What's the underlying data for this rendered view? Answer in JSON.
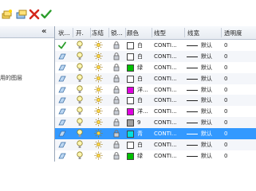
{
  "toolbar": {
    "buttons": [
      {
        "icon": "new-layer-icon"
      },
      {
        "icon": "new-layer-vp-icon"
      },
      {
        "icon": "delete-layer-icon"
      },
      {
        "icon": "set-current-icon"
      }
    ]
  },
  "left_panel": {
    "collapse_label": "«",
    "partial_text": "用的图层"
  },
  "table": {
    "headers": [
      "状...",
      "开.",
      "冻结",
      "锁...",
      "颜色",
      "线型",
      "线宽",
      "透明度"
    ],
    "rows": [
      {
        "status": "current",
        "color_hex": "#ffffff",
        "color_name": "白",
        "linetype": "CONTI...",
        "lineweight": "默认",
        "transparency": "0"
      },
      {
        "status": "layer",
        "color_hex": "#ffffff",
        "color_name": "白",
        "linetype": "CONTI...",
        "lineweight": "默认",
        "transparency": "0"
      },
      {
        "status": "layer",
        "color_hex": "#00c000",
        "color_name": "绿",
        "linetype": "CONTI...",
        "lineweight": "默认",
        "transparency": "0"
      },
      {
        "status": "layer",
        "color_hex": "#ffffff",
        "color_name": "白",
        "linetype": "CONTI...",
        "lineweight": "默认",
        "transparency": "0"
      },
      {
        "status": "layer",
        "color_hex": "#e000e0",
        "color_name": "洋...",
        "linetype": "CONTI...",
        "lineweight": "默认",
        "transparency": "0"
      },
      {
        "status": "layer",
        "color_hex": "#ffffff",
        "color_name": "白",
        "linetype": "CONTI...",
        "lineweight": "默认",
        "transparency": "0"
      },
      {
        "status": "layer",
        "color_hex": "#e000e0",
        "color_name": "洋...",
        "linetype": "CONTI...",
        "lineweight": "默认",
        "transparency": "0"
      },
      {
        "status": "layer",
        "color_hex": "#a0a0a0",
        "color_name": "9",
        "linetype": "CONTI...",
        "lineweight": "默认",
        "transparency": "0"
      },
      {
        "status": "selected",
        "color_hex": "#00e0e0",
        "color_name": "青",
        "linetype": "CONTI...",
        "lineweight": "默认",
        "transparency": "0"
      },
      {
        "status": "layer",
        "color_hex": "#ffffff",
        "color_name": "白",
        "linetype": "CONTI...",
        "lineweight": "默认",
        "transparency": "0"
      },
      {
        "status": "layer",
        "color_hex": "#00c000",
        "color_name": "绿",
        "linetype": "CONTI...",
        "lineweight": "默认",
        "transparency": "0"
      }
    ]
  },
  "colors": {
    "selection": "#3399ff",
    "check_green": "#2a9d2a",
    "layer_blue": "#4a90d9"
  }
}
